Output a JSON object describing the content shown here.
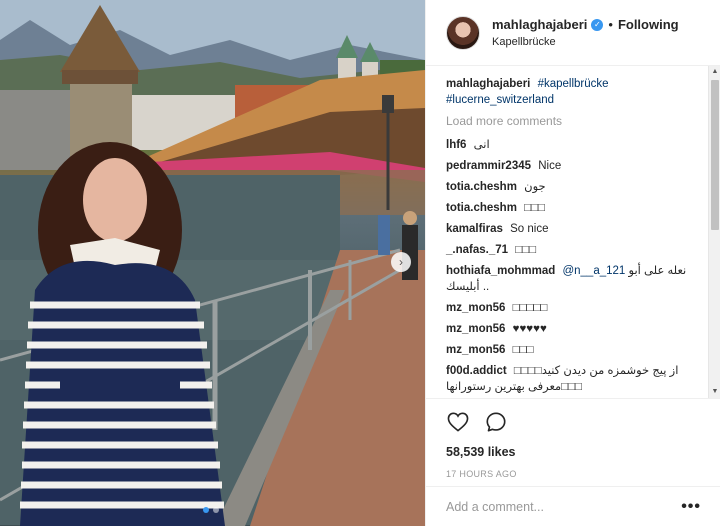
{
  "photo": {
    "alt_icon": "photo",
    "next_icon": "chevron-right-icon",
    "carousel_dots": 2,
    "active_dot": 0
  },
  "header": {
    "username": "mahlaghajaberi",
    "verified_icon": "verified-badge-icon",
    "separator": "•",
    "follow_status": "Following",
    "location": "Kapellbrücke"
  },
  "caption": {
    "username": "mahlaghajaberi",
    "hashtags": [
      "#kapellbrücke",
      "#lucerne_switzerland"
    ]
  },
  "load_more": "Load more comments",
  "comments": [
    {
      "user": "lhf6",
      "text": "انی"
    },
    {
      "user": "pedrammir2345",
      "text": "Nice"
    },
    {
      "user": "totia.cheshm",
      "text": "جون"
    },
    {
      "user": "totia.cheshm",
      "text": "□□□"
    },
    {
      "user": "kamalfiras",
      "text": "So nice"
    },
    {
      "user": "_.nafas._71",
      "text": "□□□"
    },
    {
      "user": "hothiafa_mohmmad",
      "mention": "@n__a_121",
      "text": "نعله على أبو أبليسك .."
    },
    {
      "user": "mz_mon56",
      "text": "□□□□□"
    },
    {
      "user": "mz_mon56",
      "text": "♥♥♥♥♥"
    },
    {
      "user": "mz_mon56",
      "text": "□□□"
    },
    {
      "user": "f00d.addict",
      "text": "از پیج خوشمزه من دیدن کنید□□□□ معرفی بهترین رستورانها□□□"
    }
  ],
  "actions": {
    "like_icon": "heart-icon",
    "comment_icon": "comment-bubble-icon",
    "likes": "58,539 likes",
    "timestamp": "17 HOURS AGO"
  },
  "add_comment": {
    "placeholder": "Add a comment...",
    "more_label": "•••"
  },
  "colors": {
    "link": "#003569",
    "accent": "#3897f0",
    "muted": "#999999"
  }
}
